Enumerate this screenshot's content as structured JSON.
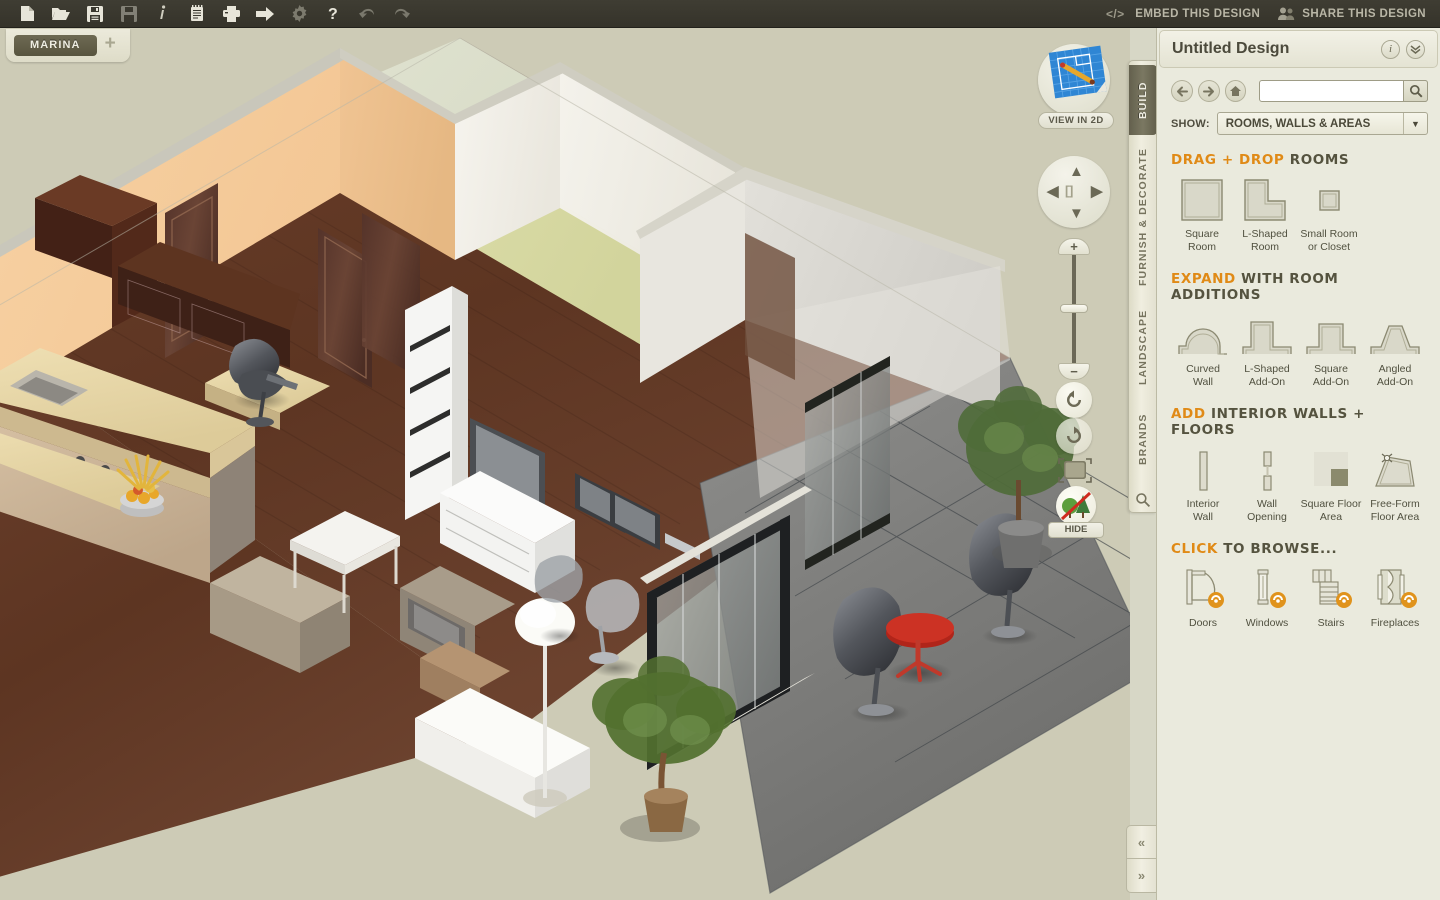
{
  "toolbar": {
    "buttons": [
      {
        "name": "new-document-icon",
        "title": "New"
      },
      {
        "name": "open-folder-icon",
        "title": "Open"
      },
      {
        "name": "save-icon",
        "title": "Save"
      },
      {
        "name": "save-as-icon",
        "title": "Save As"
      },
      {
        "name": "info-icon",
        "title": "Info"
      },
      {
        "name": "notes-icon",
        "title": "Notes"
      },
      {
        "name": "print-icon",
        "title": "Print"
      },
      {
        "name": "export-icon",
        "title": "Export"
      },
      {
        "name": "settings-gear-icon",
        "title": "Settings"
      },
      {
        "name": "help-icon",
        "title": "Help"
      },
      {
        "name": "undo-icon",
        "title": "Undo"
      },
      {
        "name": "redo-icon",
        "title": "Redo"
      }
    ],
    "embed_label": "EMBED THIS DESIGN",
    "share_label": "SHARE THIS DESIGN"
  },
  "tabstrip": {
    "document_tab": "MARINA",
    "add_tab": "+"
  },
  "viewport": {
    "view_2d_label": "VIEW IN 2D",
    "hide_label": "HIDE",
    "zoom_plus": "+",
    "zoom_minus": "−"
  },
  "vertical_tabs": [
    {
      "label": "BUILD",
      "active": true
    },
    {
      "label": "FURNISH & DECORATE",
      "active": false
    },
    {
      "label": "LANDSCAPE",
      "active": false
    },
    {
      "label": "BRANDS",
      "active": false
    }
  ],
  "panel": {
    "title": "Untitled Design",
    "info_glyph": "i",
    "collapse_glyph": "»",
    "search": {
      "value": "",
      "placeholder": ""
    },
    "show_label": "SHOW:",
    "show_value": "ROOMS, WALLS & AREAS",
    "sections": [
      {
        "id": "drag-drop-rooms",
        "title_accent": "DRAG + DROP",
        "title_rest": "ROOMS",
        "items": [
          {
            "name": "square-room",
            "label": "Square\nRoom",
            "icon": "square-room-icon"
          },
          {
            "name": "l-shaped-room",
            "label": "L-Shaped\nRoom",
            "icon": "l-shaped-room-icon"
          },
          {
            "name": "small-room-or-closet",
            "label": "Small Room\nor Closet",
            "icon": "small-room-icon"
          }
        ]
      },
      {
        "id": "room-additions",
        "title_accent": "EXPAND",
        "title_rest": "WITH ROOM ADDITIONS",
        "items": [
          {
            "name": "curved-wall",
            "label": "Curved\nWall",
            "icon": "curved-wall-icon"
          },
          {
            "name": "l-shaped-add-on",
            "label": "L-Shaped\nAdd-On",
            "icon": "l-shaped-addon-icon"
          },
          {
            "name": "square-add-on",
            "label": "Square\nAdd-On",
            "icon": "square-addon-icon"
          },
          {
            "name": "angled-add-on",
            "label": "Angled\nAdd-On",
            "icon": "angled-addon-icon"
          }
        ]
      },
      {
        "id": "interior-walls-floors",
        "title_accent": "ADD",
        "title_rest": "INTERIOR WALLS + FLOORS",
        "items": [
          {
            "name": "interior-wall",
            "label": "Interior\nWall",
            "icon": "interior-wall-icon"
          },
          {
            "name": "wall-opening",
            "label": "Wall\nOpening",
            "icon": "wall-opening-icon"
          },
          {
            "name": "square-floor-area",
            "label": "Square Floor\nArea",
            "icon": "square-floor-area-icon"
          },
          {
            "name": "free-form-floor-area",
            "label": "Free-Form\nFloor Area",
            "icon": "free-form-floor-icon"
          }
        ]
      },
      {
        "id": "click-to-browse",
        "title_accent": "CLICK",
        "title_rest": "TO BROWSE...",
        "items": [
          {
            "name": "doors",
            "label": "Doors",
            "icon": "door-icon",
            "badge": true
          },
          {
            "name": "windows",
            "label": "Windows",
            "icon": "window-icon",
            "badge": true
          },
          {
            "name": "stairs",
            "label": "Stairs",
            "icon": "stairs-icon",
            "badge": true
          },
          {
            "name": "fireplaces",
            "label": "Fireplaces",
            "icon": "fireplace-icon",
            "badge": true
          }
        ]
      }
    ]
  },
  "collapse": {
    "left_glyph": "«",
    "right_glyph": "»"
  },
  "colors": {
    "toolbar_bg": "#3a382f",
    "canvas_bg": "#cdcbb6",
    "panel_bg": "#eaeadd",
    "accent_orange": "#e08a16",
    "heading_dark": "#55533f",
    "tab_active": "#635f4c"
  }
}
